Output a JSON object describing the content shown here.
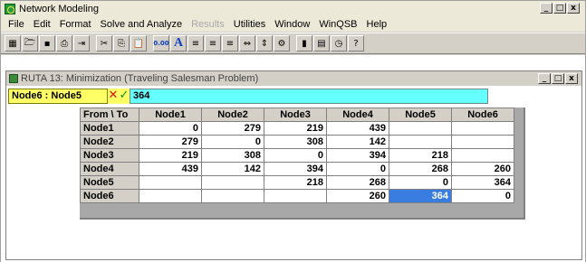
{
  "app": {
    "title": "Network Modeling"
  },
  "window_controls": {
    "minimize": "_",
    "restore": "□",
    "close": "x"
  },
  "menu": [
    "File",
    "Edit",
    "Format",
    "Solve and Analyze",
    "Results",
    "Utilities",
    "Window",
    "WinQSB",
    "Help"
  ],
  "menu_disabled_index": 4,
  "toolbar": [
    {
      "icon": "grid-icon",
      "glyph": "▦"
    },
    {
      "icon": "open-icon",
      "glyph": "🗁"
    },
    {
      "icon": "save-icon",
      "glyph": "▪"
    },
    {
      "icon": "print-icon",
      "glyph": "⎙"
    },
    {
      "icon": "solve-icon",
      "glyph": "⇥"
    },
    {
      "icon": "cut-icon",
      "glyph": "✂"
    },
    {
      "icon": "copy-icon",
      "glyph": "⎘"
    },
    {
      "icon": "paste-icon",
      "glyph": "📋"
    },
    {
      "icon": "number-format-icon",
      "glyph": "0.00"
    },
    {
      "icon": "font-icon",
      "glyph": "A"
    },
    {
      "icon": "align-left-icon",
      "glyph": "≡"
    },
    {
      "icon": "align-center-icon",
      "glyph": "≡"
    },
    {
      "icon": "align-right-icon",
      "glyph": "≡"
    },
    {
      "icon": "column-width-icon",
      "glyph": "⇔"
    },
    {
      "icon": "row-height-icon",
      "glyph": "⇕"
    },
    {
      "icon": "network-graph-icon",
      "glyph": "⚙"
    },
    {
      "icon": "chart-icon",
      "glyph": "▮"
    },
    {
      "icon": "calculator-icon",
      "glyph": "▤"
    },
    {
      "icon": "clock-icon",
      "glyph": "◷"
    },
    {
      "icon": "help-icon",
      "glyph": "?"
    }
  ],
  "child_window": {
    "title": "RUTA 13: Minimization (Traveling Salesman Problem)"
  },
  "formula_bar": {
    "cell_ref": "Node6 : Node5",
    "cancel_glyph": "✕",
    "accept_glyph": "✓",
    "value": "364"
  },
  "grid": {
    "corner": "From \\ To",
    "columns": [
      "Node1",
      "Node2",
      "Node3",
      "Node4",
      "Node5",
      "Node6"
    ],
    "rows": [
      {
        "label": "Node1",
        "cells": [
          "0",
          "279",
          "219",
          "439",
          "",
          ""
        ]
      },
      {
        "label": "Node2",
        "cells": [
          "279",
          "0",
          "308",
          "142",
          "",
          ""
        ]
      },
      {
        "label": "Node3",
        "cells": [
          "219",
          "308",
          "0",
          "394",
          "218",
          ""
        ]
      },
      {
        "label": "Node4",
        "cells": [
          "439",
          "142",
          "394",
          "0",
          "268",
          "260"
        ]
      },
      {
        "label": "Node5",
        "cells": [
          "",
          "",
          "218",
          "268",
          "0",
          "364"
        ]
      },
      {
        "label": "Node6",
        "cells": [
          "",
          "",
          "",
          "260",
          "364",
          "0"
        ]
      }
    ],
    "selected": {
      "row": 5,
      "col": 4
    }
  },
  "colors": {
    "cell_ref_bg": "#ffff66",
    "entry_bg": "#66ffff",
    "selected_cell": "#3a7de0"
  }
}
